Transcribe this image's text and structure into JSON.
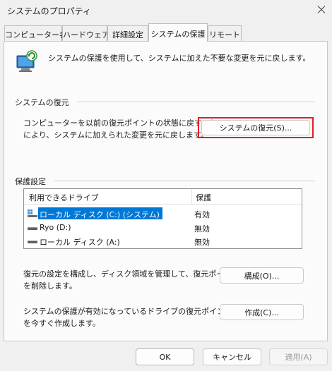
{
  "window": {
    "title": "システムのプロパティ"
  },
  "tabs": [
    {
      "label": "コンピューター名",
      "active": false
    },
    {
      "label": "ハードウェア",
      "active": false
    },
    {
      "label": "詳細設定",
      "active": false
    },
    {
      "label": "システムの保護",
      "active": true
    },
    {
      "label": "リモート",
      "active": false
    }
  ],
  "intro": {
    "text": "システムの保護を使用して、システムに加えた不要な変更を元に戻します。"
  },
  "restore_section": {
    "title": "システムの復元",
    "description_line1": "コンピューターを以前の復元ポイントの状態に戻すこと",
    "description_line2": "により、システムに加えられた変更を元に戻します。",
    "button_label": "システムの復元(S)..."
  },
  "protection_section": {
    "title": "保護設定",
    "columns": [
      "利用できるドライブ",
      "保護"
    ],
    "drives": [
      {
        "name": "ローカル ディスク (C:) (システム)",
        "protection": "有効",
        "selected": true,
        "icon": "system-drive-icon"
      },
      {
        "name": "Ryo (D:)",
        "protection": "無効",
        "selected": false,
        "icon": "drive-icon"
      },
      {
        "name": "ローカル ディスク (A:)",
        "protection": "無効",
        "selected": false,
        "icon": "drive-icon"
      }
    ],
    "configure_text_line1": "復元の設定を構成し、ディスク領域を管理して、復元ポイント",
    "configure_text_line2": "を削除します。",
    "configure_button": "構成(O)...",
    "create_text_line1": "システムの保護が有効になっているドライブの復元ポイント",
    "create_text_line2": "を今すぐ作成します。",
    "create_button": "作成(C)..."
  },
  "footer": {
    "ok": "OK",
    "cancel": "キャンセル",
    "apply": "適用(A)"
  },
  "colors": {
    "selection": "#0078d7",
    "highlight_border": "#e02020",
    "panel": "#fbfbfb"
  }
}
